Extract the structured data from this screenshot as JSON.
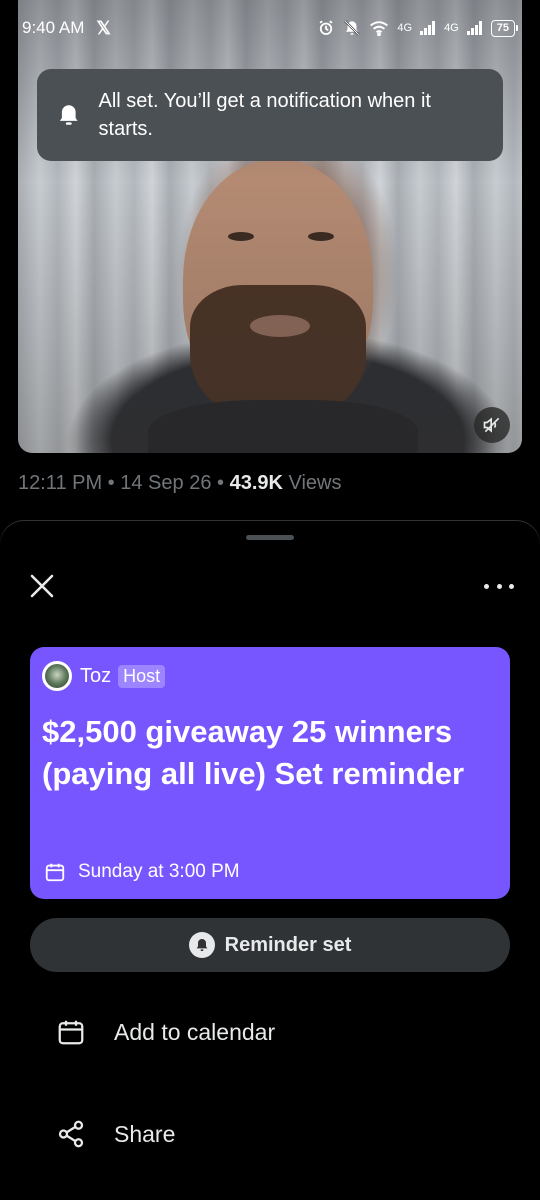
{
  "status_bar": {
    "time": "9:40 AM",
    "app_icon": "x-logo",
    "network_1": "4G",
    "network_2": "4G",
    "battery": "75"
  },
  "toast": {
    "icon": "bell-icon",
    "message": "All set. You’ll get a notification when it starts."
  },
  "post_meta": {
    "time": "12:11 PM",
    "sep1": " • ",
    "date": "14 Sep 26",
    "sep2": " • ",
    "views_count": "43.9K",
    "views_label": " Views"
  },
  "space_card": {
    "host_name": "Toz",
    "host_badge": "Host",
    "title": "$2,500 giveaway 25 winners (paying all live) Set reminder",
    "schedule": "Sunday at 3:00 PM",
    "background_color": "#7856ff"
  },
  "reminder_button": {
    "label": "Reminder set"
  },
  "actions": {
    "calendar_label": "Add to calendar",
    "share_label": "Share"
  }
}
